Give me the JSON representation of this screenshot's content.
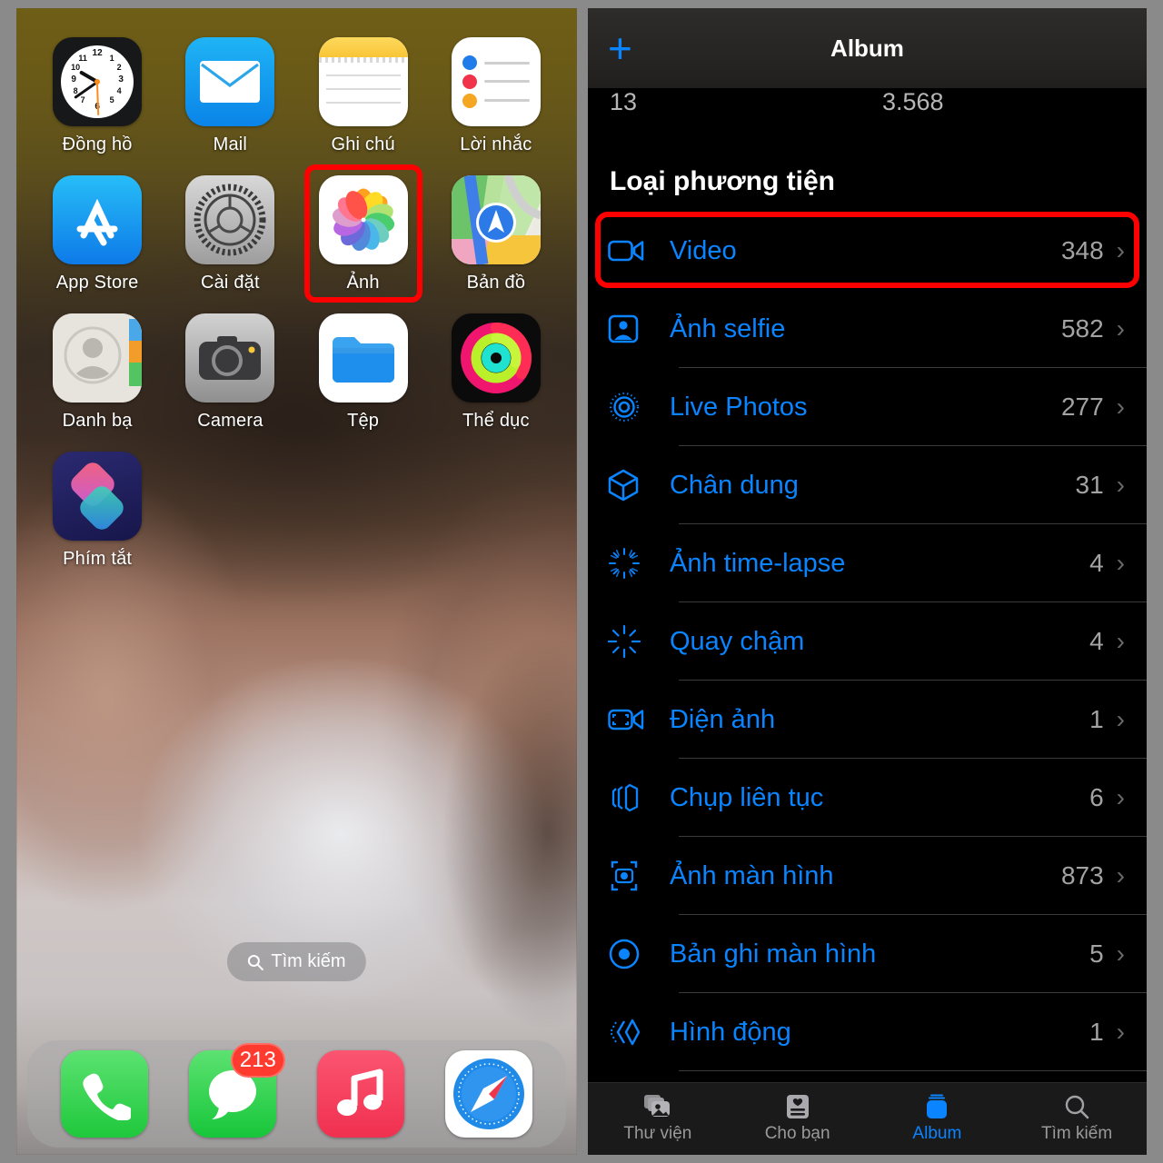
{
  "home": {
    "apps": [
      {
        "label": "Đồng hồ",
        "icon": "clock-icon",
        "name": "app-clock"
      },
      {
        "label": "Mail",
        "icon": "mail-icon",
        "name": "app-mail"
      },
      {
        "label": "Ghi chú",
        "icon": "notes-icon",
        "name": "app-notes"
      },
      {
        "label": "Lời nhắc",
        "icon": "reminders-icon",
        "name": "app-reminders"
      },
      {
        "label": "App Store",
        "icon": "app-store-icon",
        "name": "app-appstore"
      },
      {
        "label": "Cài đặt",
        "icon": "settings-gear-icon",
        "name": "app-settings"
      },
      {
        "label": "Ảnh",
        "icon": "photos-icon",
        "name": "app-photos"
      },
      {
        "label": "Bản đồ",
        "icon": "maps-icon",
        "name": "app-maps"
      },
      {
        "label": "Danh bạ",
        "icon": "contacts-icon",
        "name": "app-contacts"
      },
      {
        "label": "Camera",
        "icon": "camera-icon",
        "name": "app-camera"
      },
      {
        "label": "Tệp",
        "icon": "files-folder-icon",
        "name": "app-files"
      },
      {
        "label": "Thể dục",
        "icon": "fitness-rings-icon",
        "name": "app-fitness"
      },
      {
        "label": "Phím tắt",
        "icon": "shortcuts-icon",
        "name": "app-shortcuts"
      }
    ],
    "highlighted_app": "Ảnh",
    "search": {
      "label": "Tìm kiếm",
      "icon": "search-icon"
    },
    "dock": [
      {
        "label": "Phone",
        "icon": "phone-icon",
        "name": "dock-phone",
        "badge": ""
      },
      {
        "label": "Messages",
        "icon": "messages-icon",
        "name": "dock-messages",
        "badge": "213"
      },
      {
        "label": "Music",
        "icon": "music-note-icon",
        "name": "dock-music",
        "badge": ""
      },
      {
        "label": "Safari",
        "icon": "safari-compass-icon",
        "name": "dock-safari",
        "badge": ""
      }
    ],
    "highlight_color": "#ff0000"
  },
  "photos": {
    "nav": {
      "add_label": "+",
      "title": "Album"
    },
    "partial_stats": {
      "left": "13",
      "right": "3.568"
    },
    "section_title": "Loại phương tiện",
    "accent_color": "#0a84ff",
    "highlight_color": "#ff0000",
    "media_types": [
      {
        "label": "Video",
        "count": "348",
        "icon": "video-camera-icon",
        "highlighted": true
      },
      {
        "label": "Ảnh selfie",
        "count": "582",
        "icon": "selfie-person-icon",
        "highlighted": false
      },
      {
        "label": "Live Photos",
        "count": "277",
        "icon": "live-photo-icon",
        "highlighted": false
      },
      {
        "label": "Chân dung",
        "count": "31",
        "icon": "portrait-cube-icon",
        "highlighted": false
      },
      {
        "label": "Ảnh time-lapse",
        "count": "4",
        "icon": "timelapse-icon",
        "highlighted": false
      },
      {
        "label": "Quay chậm",
        "count": "4",
        "icon": "slow-motion-icon",
        "highlighted": false
      },
      {
        "label": "Điện ảnh",
        "count": "1",
        "icon": "cinematic-video-icon",
        "highlighted": false
      },
      {
        "label": "Chụp liên tục",
        "count": "6",
        "icon": "burst-icon",
        "highlighted": false
      },
      {
        "label": "Ảnh màn hình",
        "count": "873",
        "icon": "screenshot-icon",
        "highlighted": false
      },
      {
        "label": "Bản ghi màn hình",
        "count": "5",
        "icon": "screen-recording-icon",
        "highlighted": false
      },
      {
        "label": "Hình động",
        "count": "1",
        "icon": "animated-icon",
        "highlighted": false
      }
    ],
    "chevron": "›",
    "tabs": [
      {
        "label": "Thư viện",
        "icon": "library-photos-icon",
        "active": false
      },
      {
        "label": "Cho bạn",
        "icon": "for-you-icon",
        "active": false
      },
      {
        "label": "Album",
        "icon": "albums-icon",
        "active": true
      },
      {
        "label": "Tìm kiếm",
        "icon": "search-icon",
        "active": false
      }
    ]
  }
}
